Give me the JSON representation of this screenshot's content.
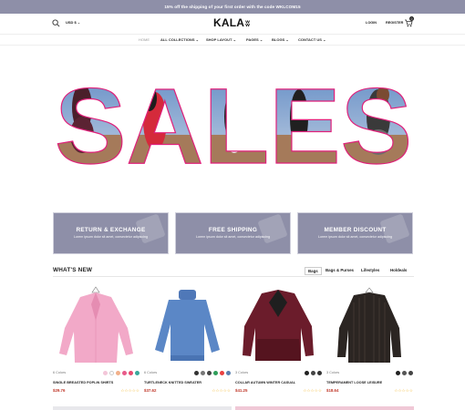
{
  "topbar": {
    "announcement": "15% off the shipping of your first order with the code WKLCOM15"
  },
  "header": {
    "currency": "USD $",
    "logo": "KALA",
    "login": "LOGIN",
    "register": "REGISTER",
    "cart_count": "0"
  },
  "nav": {
    "items": [
      {
        "label": "HOME"
      },
      {
        "label": "ALL COLLECTIONS"
      },
      {
        "label": "SHOP LAYOUT"
      },
      {
        "label": "PAGES"
      },
      {
        "label": "BLOGS"
      },
      {
        "label": "CONTACT US"
      }
    ]
  },
  "hero": {
    "headline": "SALES",
    "slide_count": 3,
    "active_slide": 1,
    "outline_color": "#e0207a"
  },
  "promos": [
    {
      "title": "RETURN & EXCHANGE",
      "desc": "Lorem ipsum dolor sit amet, consectetur adipiscing"
    },
    {
      "title": "FREE SHIPPING",
      "desc": "Lorem ipsum dolor sit amet, consectetur adipiscing"
    },
    {
      "title": "MEMBER DISCOUNT",
      "desc": "Lorem ipsum dolor sit amet, consectetur adipiscing"
    }
  ],
  "section": {
    "title": "WHAT'S NEW",
    "tabs": [
      {
        "label": "Bags"
      },
      {
        "label": "Bags & Purses"
      },
      {
        "label": "Lifestyles"
      },
      {
        "label": "Holdeals"
      }
    ]
  },
  "products": [
    {
      "colors": "6 Colors",
      "name": "SINGLE BREASTED POPLIN SHIRTS",
      "price": "$29.76",
      "stars": "☆☆☆☆☆",
      "swatches": [
        "#f3c6d9",
        "#ffffff",
        "#f2b08a",
        "#e85b8a",
        "#e84a6e",
        "#3aa89b"
      ]
    },
    {
      "colors": "6 Colors",
      "name": "TURTLENECK KNITTED SWEATER",
      "price": "$37.62",
      "stars": "☆☆☆☆☆",
      "swatches": [
        "#333333",
        "#777777",
        "#444444",
        "#2f9e5a",
        "#e94040",
        "#5a7fb0"
      ]
    },
    {
      "colors": "3 Colors",
      "name": "COLLAR AUTUMN WINTER CASUAL",
      "price": "$41.25",
      "stars": "☆☆☆☆☆",
      "swatches": [
        "#222222",
        "#444444",
        "#333333"
      ]
    },
    {
      "colors": "3 Colors",
      "name": "TEMPERAMENT LOOSE LEISURE",
      "price": "$18.64",
      "stars": "☆☆☆☆☆",
      "swatches": [
        "#222222",
        "#555555",
        "#444444"
      ]
    }
  ],
  "colors": {
    "accent": "#8e8fa8",
    "price": "#c0392b",
    "star": "#f0b429"
  }
}
